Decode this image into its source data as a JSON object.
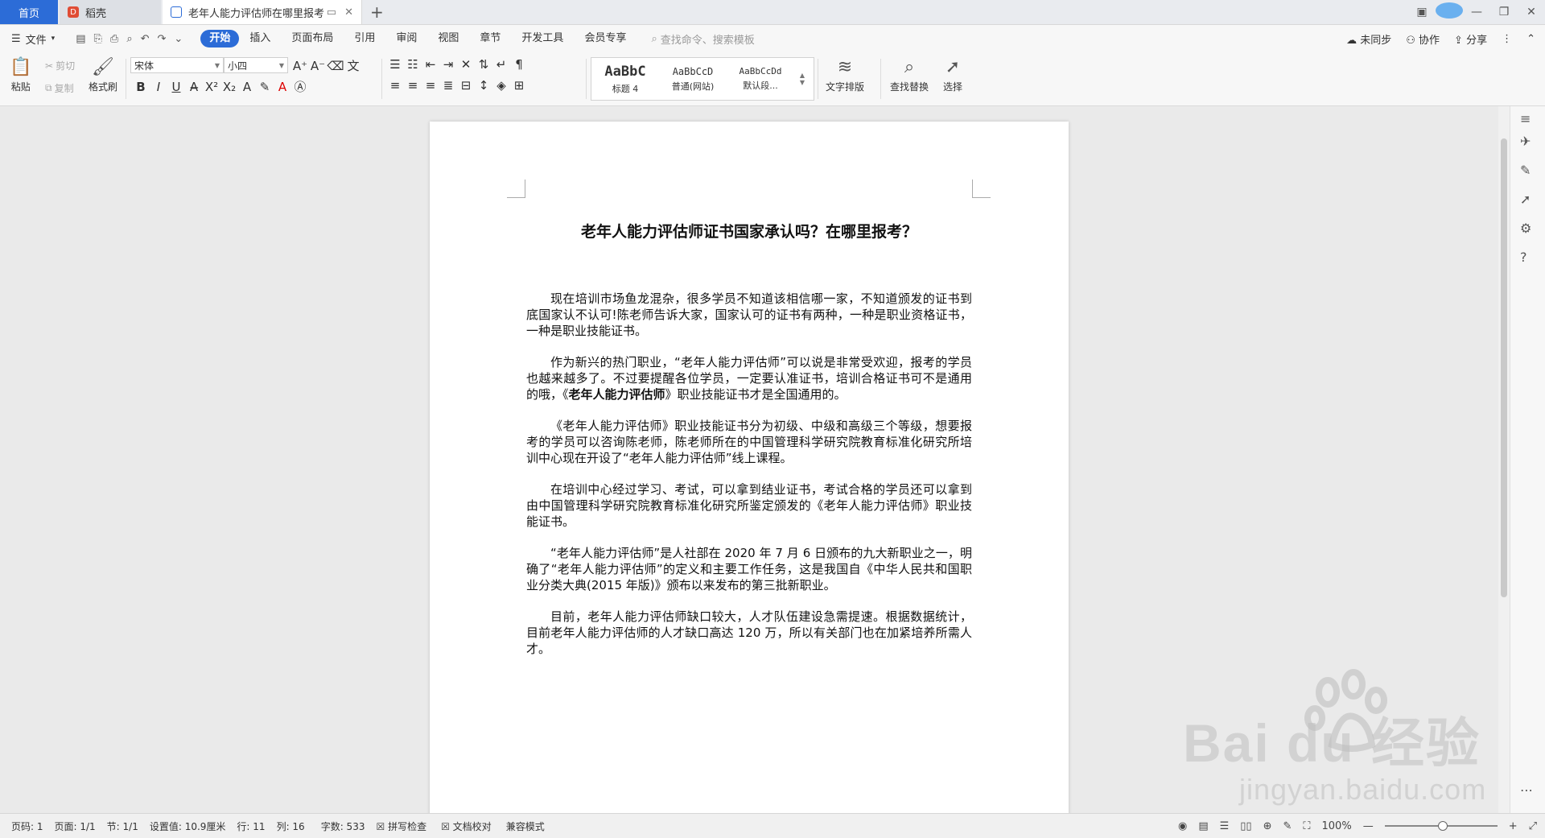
{
  "tabs": {
    "home": "首页",
    "daoke": "稻壳",
    "doc": "老年人能力评估师在哪里报考"
  },
  "menu": {
    "file": "文件",
    "tabs": [
      "开始",
      "插入",
      "页面布局",
      "引用",
      "审阅",
      "视图",
      "章节",
      "开发工具",
      "会员专享"
    ],
    "search_placeholder": "查找命令、搜索模板",
    "sync": "未同步",
    "collab": "协作",
    "share": "分享"
  },
  "ribbon": {
    "paste": "粘贴",
    "cut": "剪切",
    "copy": "复制",
    "format_painter": "格式刷",
    "font_name": "宋体",
    "font_size": "小四",
    "styles": [
      {
        "preview": "AaBbC",
        "name": "标题 4"
      },
      {
        "preview": "AaBbCcD",
        "name": "普通(网站)"
      },
      {
        "preview": "AaBbCcDd",
        "name": "默认段..."
      }
    ],
    "text_layout": "文字排版",
    "find_replace": "查找替换",
    "select": "选择"
  },
  "document": {
    "title": "老年人能力评估师证书国家承认吗？在哪里报考？",
    "p1": "现在培训市场鱼龙混杂，很多学员不知道该相信哪一家，不知道颁发的证书到底国家认不认可!陈老师告诉大家，国家认可的证书有两种，一种是职业资格证书，一种是职业技能证书。",
    "p2_a": "作为新兴的热门职业，“老年人能力评估师”可以说是非常受欢迎，报考的学员也越来越多了。不过要提醒各位学员，一定要认准证书，培训合格证书可不是通用的哦，《",
    "p2_bold": "老年人能力评估师",
    "p2_b": "》职业技能证书才是全国通用的。",
    "p3": "《老年人能力评估师》职业技能证书分为初级、中级和高级三个等级，想要报考的学员可以咨询陈老师，陈老师所在的中国管理科学研究院教育标准化研究所培训中心现在开设了“老年人能力评估师”线上课程。",
    "p4": "在培训中心经过学习、考试，可以拿到结业证书，考试合格的学员还可以拿到由中国管理科学研究院教育标准化研究所鉴定颁发的《老年人能力评估师》职业技能证书。",
    "p5": "“老年人能力评估师”是人社部在 2020 年 7 月 6 日颁布的九大新职业之一，明确了“老年人能力评估师”的定义和主要工作任务，这是我国自《中华人民共和国职业分类大典(2015 年版)》颁布以来发布的第三批新职业。",
    "p6": "目前，老年人能力评估师缺口较大，人才队伍建设急需提速。根据数据统计，目前老年人能力评估师的人才缺口高达 120 万，所以有关部门也在加紧培养所需人才。"
  },
  "status": {
    "page_no": "页码: 1",
    "pages": "页面: 1/1",
    "section": "节: 1/1",
    "setting": "设置值: 10.9厘米",
    "row": "行: 11",
    "col": "列: 16",
    "words": "字数: 533",
    "spell": "拼写检查",
    "proof": "文档校对",
    "compat": "兼容模式",
    "zoom": "100%"
  },
  "watermark": {
    "logo": "Bai du 经验",
    "url": "jingyan.baidu.com"
  }
}
